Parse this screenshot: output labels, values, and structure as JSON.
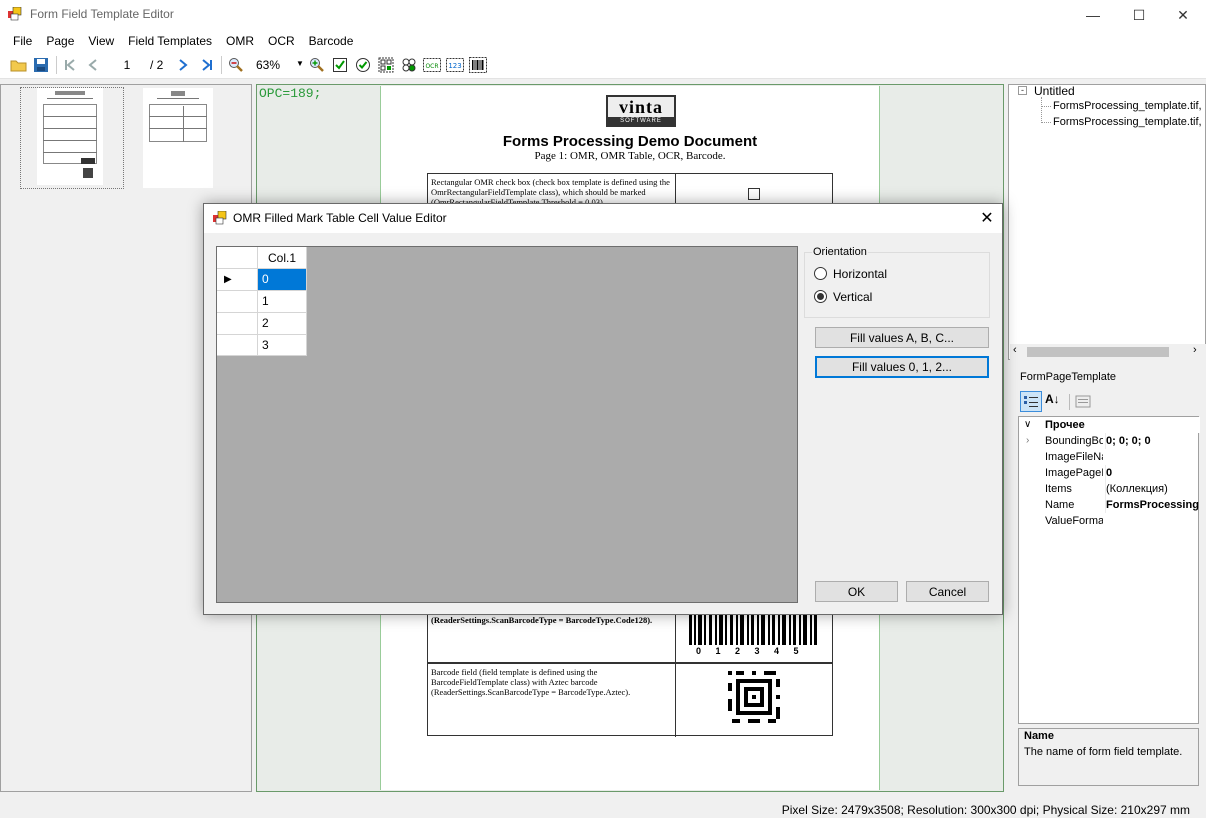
{
  "window": {
    "title": "Form Field Template Editor"
  },
  "menu": [
    "File",
    "Page",
    "View",
    "Field Templates",
    "OMR",
    "OCR",
    "Barcode"
  ],
  "toolbar": {
    "page_current": "1",
    "page_total": "/ 2",
    "zoom": "63%"
  },
  "document": {
    "opc_text": "OPC=189;",
    "logo_main": "vinta",
    "logo_sub": "SOFTWARE",
    "title": "Forms Processing Demo Document",
    "subtitle": "Page 1: OMR, OMR Table, OCR, Barcode.",
    "omr_box_text": "Rectangular OMR check box (check box template is defined using the OmrRectangularFieldTemplate class), which should be marked (OmrRectangularFieldTemplate.Threshold = 0.03).",
    "barcode1_text": "(ReaderSettings.ScanBarcodeType = BarcodeType.Code128).",
    "barcode1_digits": "0 1 2 3 4 5",
    "barcode2_text": "Barcode field (field template is defined using the BarcodeFieldTemplate class) with Aztec barcode (ReaderSettings.ScanBarcodeType = BarcodeType.Aztec)."
  },
  "tree": {
    "root": "Untitled",
    "children": [
      "FormsProcessing_template.tif, Pa",
      "FormsProcessing_template.tif, Pa"
    ]
  },
  "properties": {
    "object": "FormPageTemplate",
    "category": "Прочее",
    "rows": [
      {
        "name": "BoundingBox",
        "value": "0; 0; 0; 0",
        "bold": true
      },
      {
        "name": "ImageFileName",
        "value": "",
        "bold": false
      },
      {
        "name": "ImagePageIndex",
        "value": "0",
        "bold": true
      },
      {
        "name": "Items",
        "value": "(Коллекция)",
        "bold": false
      },
      {
        "name": "Name",
        "value": "FormsProcessing",
        "bold": true
      },
      {
        "name": "ValueFormat",
        "value": "",
        "bold": false
      }
    ],
    "description_title": "Name",
    "description_text": "The name of form field template."
  },
  "status": {
    "text": "Pixel Size: 2479x3508; Resolution: 300x300 dpi; Physical Size: 210x297 mm"
  },
  "dialog": {
    "title": "OMR Filled Mark Table Cell Value Editor",
    "column_header": "Col.1",
    "cells": [
      "0",
      "1",
      "2",
      "3"
    ],
    "orientation_label": "Orientation",
    "horizontal_label": "Horizontal",
    "vertical_label": "Vertical",
    "orientation_selected": "Vertical",
    "fill_letters_button": "Fill values A, B, C...",
    "fill_numbers_button": "Fill values 0, 1, 2...",
    "ok_button": "OK",
    "cancel_button": "Cancel"
  },
  "colors": {
    "accent": "#0078d7",
    "opc_green": "#2a9a3a",
    "grid_bg": "#ababab"
  }
}
